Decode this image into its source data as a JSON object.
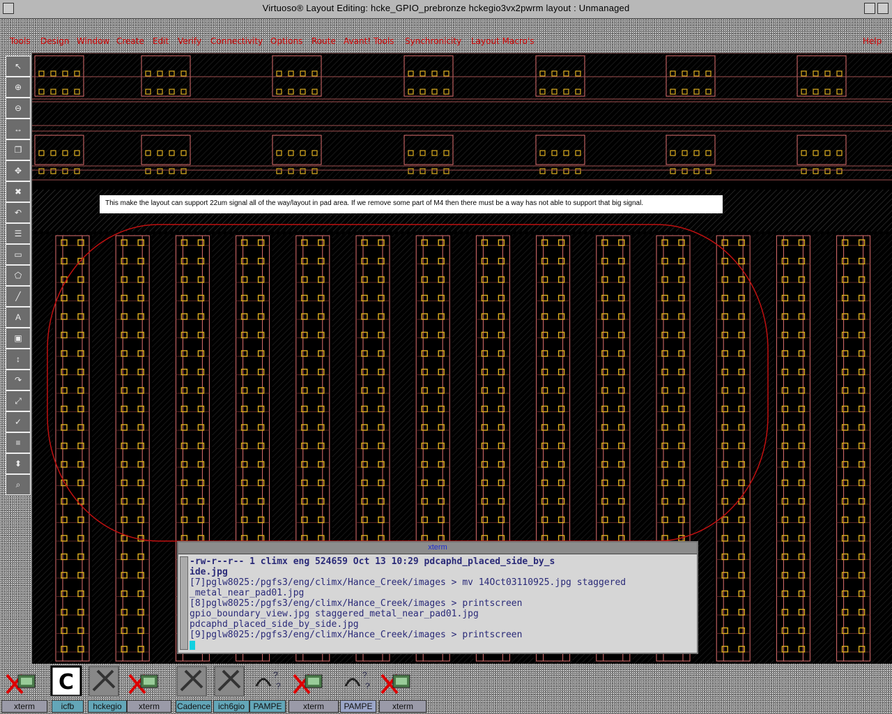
{
  "window": {
    "title": "Virtuoso® Layout Editing: hcke_GPIO_prebronze hckegio3vx2pwrm layout : Unmanaged"
  },
  "menu": {
    "items": [
      "Tools",
      "Design",
      "Window",
      "Create",
      "Edit",
      "Verify",
      "Connectivity",
      "Options",
      "Route",
      "Avant! Tools",
      "Synchronicity",
      "Layout Macro's"
    ],
    "help": "Help"
  },
  "toolbar": {
    "buttons": [
      "pointer-icon",
      "zoom-in-icon",
      "zoom-out-icon",
      "stretch-icon",
      "copy-icon",
      "move-icon",
      "delete-icon",
      "undo-icon",
      "property-icon",
      "rectangle-icon",
      "polygon-icon",
      "path-icon",
      "label-icon",
      "instance-icon",
      "ruler-icon",
      "redo-icon",
      "fit-icon",
      "save-icon",
      "layer-icon",
      "hierarchy-icon",
      "search-icon"
    ]
  },
  "annotation": {
    "text": "This make the layout can support 22um signal all of the way/layout in pad area. If we remove some part of M4 then there must be a way has not able to support that big signal."
  },
  "xterm": {
    "title": "xterm",
    "lines": [
      "-rw-r--r--   1 climx    eng      524659 Oct 13 10:29 pdcaphd_placed_side_by_s",
      "ide.jpg",
      "[7]pglw8025:/pgfs3/eng/climx/Hance_Creek/images > mv 14Oct03110925.jpg staggered",
      "_metal_near_pad01.jpg",
      "[8]pglw8025:/pgfs3/eng/climx/Hance_Creek/images > printscreen",
      "gpio_boundary_view.jpg      staggered_metal_near_pad01.jpg",
      "pdcaphd_placed_side_by_side.jpg",
      "[9]pglw8025:/pgfs3/eng/climx/Hance_Creek/images > printscreen"
    ]
  },
  "tray_icons": [
    "xterm-icon",
    "cadence-c-icon",
    "schematic-icon",
    "xterm-icon",
    "network-icon",
    "hammer-icon",
    "help-icon",
    "xterm-icon",
    "help-icon",
    "xterm-icon"
  ],
  "taskbar": {
    "items": [
      "xterm",
      "icfb",
      "hckegio",
      "xterm",
      "Cadence",
      "ich6gio",
      "PAMPE",
      "xterm",
      "PAMPE",
      "xterm"
    ]
  },
  "colors": {
    "menu_text": "#d00000",
    "layout_bg": "#000000",
    "cell_outline": "#e07070",
    "via_fill": "#e0b020",
    "annotation_ellipse": "#c01010",
    "cursor": "#11d0e0"
  }
}
